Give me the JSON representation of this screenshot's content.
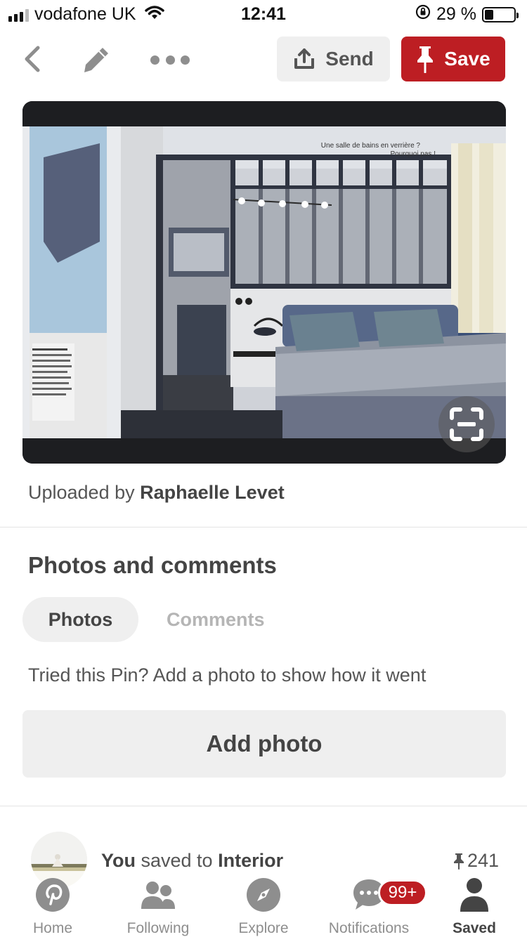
{
  "status_bar": {
    "carrier": "vodafone UK",
    "time": "12:41",
    "battery_percent": "29 %",
    "battery_level": 0.29
  },
  "action_bar": {
    "send_label": "Send",
    "save_label": "Save"
  },
  "pin": {
    "image_caption_line1": "Une salle de bains en verrière ?",
    "image_caption_line2": "Pourquoi pas !",
    "uploaded_prefix": "Uploaded by ",
    "uploader": "Raphaelle Levet"
  },
  "photos_comments": {
    "title": "Photos and comments",
    "tab_photos": "Photos",
    "tab_comments": "Comments",
    "prompt": "Tried this Pin? Add a photo to show how it went",
    "add_photo_label": "Add photo"
  },
  "saved_activity": {
    "you": "You",
    "middle": " saved to ",
    "board": "Interior",
    "save_count": "241"
  },
  "tab_bar": {
    "items": [
      {
        "label": "Home",
        "icon": "pinterest-logo-icon"
      },
      {
        "label": "Following",
        "icon": "people-icon"
      },
      {
        "label": "Explore",
        "icon": "compass-icon"
      },
      {
        "label": "Notifications",
        "icon": "speech-bubble-icon",
        "badge": "99+"
      },
      {
        "label": "Saved",
        "icon": "person-icon"
      }
    ]
  },
  "colors": {
    "brand_red": "#bd1e23",
    "button_grey": "#efefef"
  }
}
